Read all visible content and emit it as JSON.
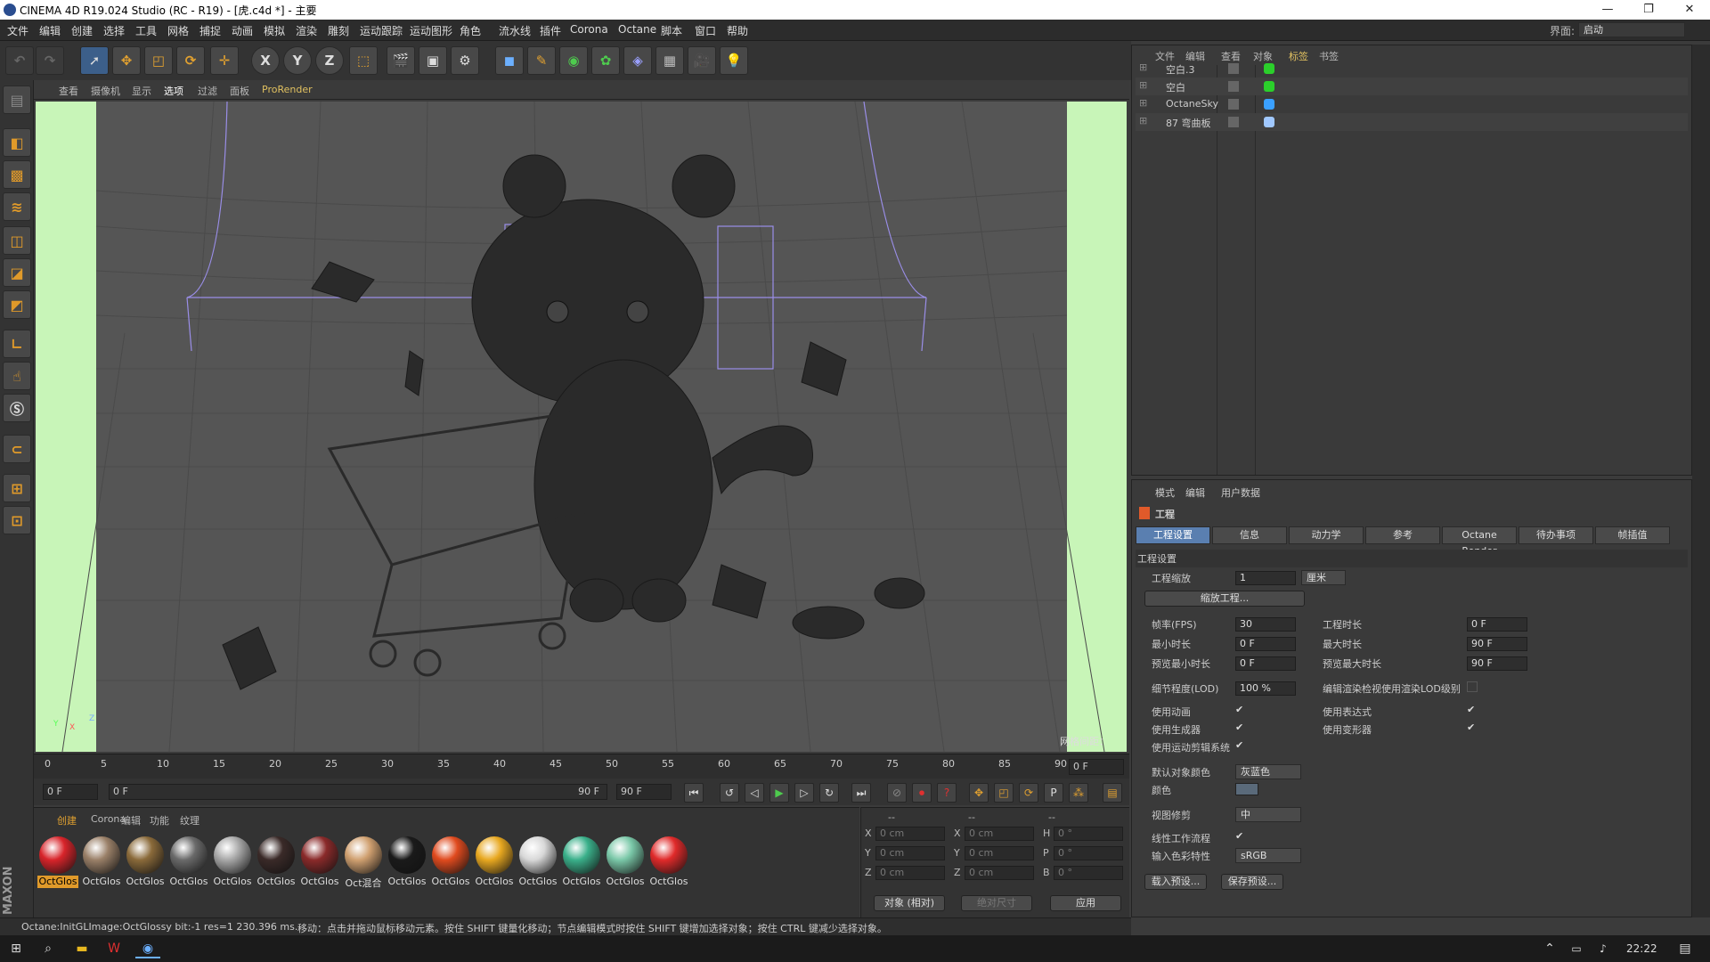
{
  "window": {
    "title": "CINEMA 4D R19.024 Studio (RC - R19) - [虎.c4d *] - 主要",
    "min": "—",
    "max": "❐",
    "close": "✕"
  },
  "menubar": {
    "items": [
      "文件",
      "编辑",
      "创建",
      "选择",
      "工具",
      "网格",
      "捕捉",
      "动画",
      "模拟",
      "渲染",
      "雕刻",
      "运动跟踪",
      "运动图形",
      "角色",
      "流水线",
      "插件",
      "Corona",
      "Octane",
      "脚本",
      "窗口",
      "帮助"
    ],
    "layout_label": "界面:",
    "layout_value": "启动"
  },
  "toolbar": {
    "axis_x": "X",
    "axis_y": "Y",
    "axis_z": "Z"
  },
  "viewport_menu": [
    "查看",
    "摄像机",
    "显示",
    "选项",
    "过滤",
    "面板",
    "ProRender"
  ],
  "viewport": {
    "grid_label": "网格间距：",
    "axis_y": "Y",
    "axis_z": "Z",
    "axis_x": "X"
  },
  "timeline": {
    "ticks": [
      "0",
      "5",
      "10",
      "15",
      "20",
      "25",
      "30",
      "35",
      "40",
      "45",
      "50",
      "55",
      "60",
      "65",
      "70",
      "75",
      "80",
      "85",
      "90"
    ],
    "current": "0 F"
  },
  "time_controls": {
    "start": "0 F",
    "range_start": "0 F",
    "range_end": "90 F",
    "end": "90 F"
  },
  "materials": {
    "tabs": [
      "创建",
      "Corona",
      "编辑",
      "功能",
      "纹理"
    ],
    "items": [
      {
        "label": "OctGlos",
        "color": "#d8242a"
      },
      {
        "label": "OctGlos",
        "color": "#9a8068"
      },
      {
        "label": "OctGlos",
        "color": "#8a6a3a"
      },
      {
        "label": "OctGlos",
        "color": "#6a6a6a"
      },
      {
        "label": "OctGlos",
        "color": "#a8a8a8"
      },
      {
        "label": "OctGlos",
        "color": "#3a2a28"
      },
      {
        "label": "OctGlos",
        "color": "#8a2a2a"
      },
      {
        "label": "Oct混合",
        "color": "#d0a070"
      },
      {
        "label": "OctGlos",
        "color": "#1a1a1a"
      },
      {
        "label": "OctGlos",
        "color": "#e04a1e"
      },
      {
        "label": "OctGlos",
        "color": "#e8a820"
      },
      {
        "label": "OctGlos",
        "color": "#d8d8d8"
      },
      {
        "label": "OctGlos",
        "color": "#3ab08a"
      },
      {
        "label": "OctGlos",
        "color": "#7ac8a8"
      },
      {
        "label": "OctGlos",
        "color": "#e02a2a"
      }
    ]
  },
  "coords": {
    "headers": [
      "--",
      "--",
      "--"
    ],
    "rows": [
      {
        "a": "X",
        "av": "0 cm",
        "b": "X",
        "bv": "0 cm",
        "c": "H",
        "cv": "0 °"
      },
      {
        "a": "Y",
        "av": "0 cm",
        "b": "Y",
        "bv": "0 cm",
        "c": "P",
        "cv": "0 °"
      },
      {
        "a": "Z",
        "av": "0 cm",
        "b": "Z",
        "bv": "0 cm",
        "c": "B",
        "cv": "0 °"
      }
    ],
    "mode": "对象 (相对)",
    "size_mode": "绝对尺寸",
    "apply": "应用"
  },
  "status": {
    "left": "Octane:InitGLImage:OctGlossy  bit:-1 res=1  230.396 ms.",
    "right": "移动：点击并拖动鼠标移动元素。按住 SHIFT 键量化移动；节点编辑模式时按住 SHIFT 键增加选择对象；按住 CTRL 键减少选择对象。"
  },
  "objects": {
    "tabs": [
      "文件",
      "编辑",
      "查看",
      "对象",
      "标签",
      "书签"
    ],
    "rows": [
      {
        "name": "空白.3"
      },
      {
        "name": "空白"
      },
      {
        "name": "OctaneSky"
      },
      {
        "name": "87 弯曲板"
      }
    ]
  },
  "attributes": {
    "tabs_top": [
      "模式",
      "编辑",
      "用户数据"
    ],
    "section_title": "工程",
    "tabs": [
      "工程设置",
      "信息",
      "动力学",
      "参考",
      "Octane Render",
      "待办事项",
      "帧插值"
    ],
    "group_title": "工程设置",
    "scale_label": "工程缩放",
    "scale_value": "1",
    "scale_unit": "厘米",
    "scale_button": "缩放工程...",
    "fps_label": "帧率(FPS)",
    "fps_value": "30",
    "duration_label": "工程时长",
    "duration_value": "0 F",
    "min_label": "最小时长",
    "min_value": "0 F",
    "max_label": "最大时长",
    "max_value": "90 F",
    "pmin_label": "预览最小时长",
    "pmin_value": "0 F",
    "pmax_label": "预览最大时长",
    "pmax_value": "90 F",
    "lod_label": "细节程度(LOD)",
    "lod_value": "100 %",
    "lod_render_label": "编辑渲染检视使用渲染LOD级别",
    "use_anim": "使用动画",
    "use_expr": "使用表达式",
    "use_gen": "使用生成器",
    "use_deform": "使用变形器",
    "use_motion": "使用运动剪辑系统",
    "default_color_label": "默认对象颜色",
    "default_color_value": "灰蓝色",
    "color_label": "颜色",
    "view_clip_label": "视图修剪",
    "view_clip_value": "中",
    "linear_label": "线性工作流程",
    "input_color_label": "输入色彩特性",
    "input_color_value": "sRGB",
    "load_preset": "载入预设...",
    "save_preset": "保存预设..."
  },
  "taskbar": {
    "time": "22:22"
  }
}
